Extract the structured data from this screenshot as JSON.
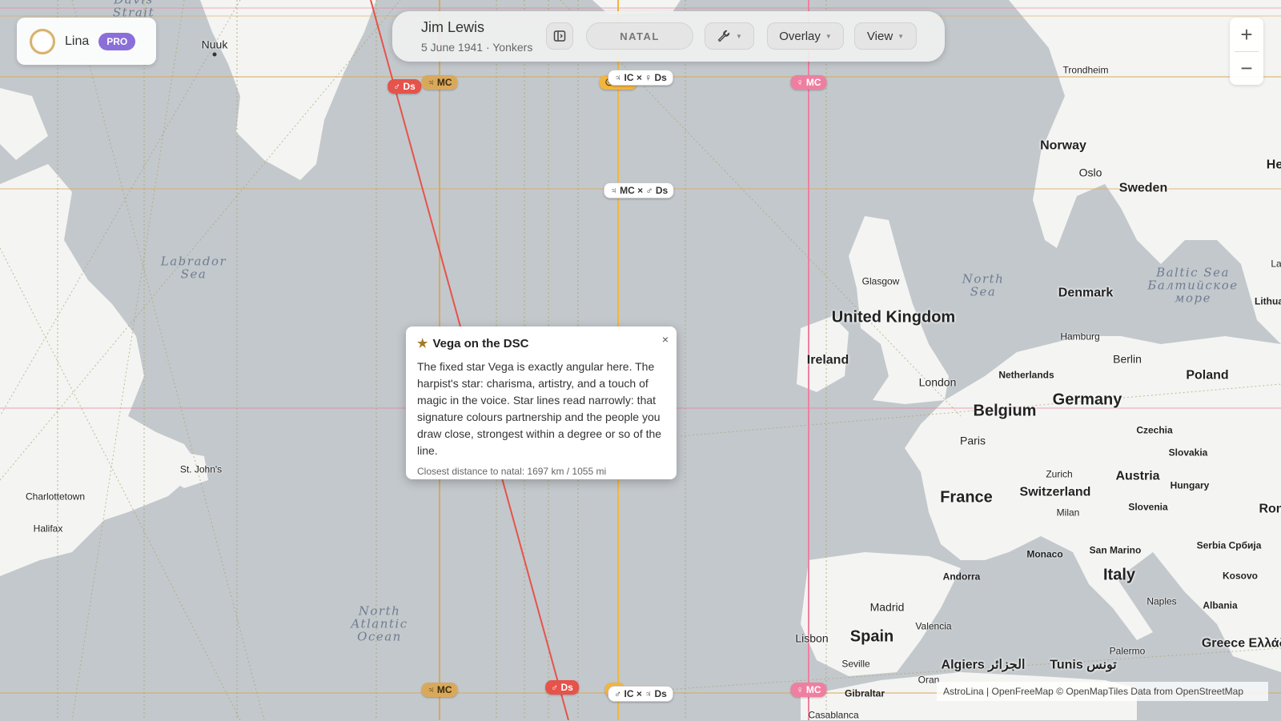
{
  "user": {
    "name": "Lina",
    "badge": "PRO"
  },
  "header": {
    "person_name": "Jim Lewis",
    "person_sub": "5 June 1941 · Yonkers",
    "natal_label": "NATAL",
    "overlay_label": "Overlay",
    "view_label": "View"
  },
  "zoom": {
    "in": "+",
    "out": "−"
  },
  "popup": {
    "title": "Vega on the DSC",
    "close": "×",
    "body": "The fixed star Vega is exactly angular here. The harpist's star: charisma, artistry, and a touch of magic in the voice. Star lines read narrowly: that signature colours partnership and the people you draw close, strongest within a degree or so of the line.",
    "footer": "Closest distance to natal: 1697 km / 1055 mi"
  },
  "attribution": "AstroLina | OpenFreeMap © OpenMapTiles Data from OpenStreetMap",
  "line_tags": [
    {
      "text": "♂ Ds",
      "color": "red"
    },
    {
      "text": "♃ MC",
      "color": "orange"
    },
    {
      "text": "♃ IC × ♀ Ds",
      "color": "white"
    },
    {
      "text": "♀ MC",
      "color": "pink"
    },
    {
      "text": "♃ MC × ♂ Ds",
      "color": "white"
    },
    {
      "text": "♃ MC",
      "color": "orange"
    },
    {
      "text": "♂ Ds",
      "color": "red"
    },
    {
      "text": "♂ IC × ♃ Ds",
      "color": "white"
    },
    {
      "text": "♀ MC",
      "color": "pink"
    },
    {
      "text": "☉ MC",
      "color": "yellow"
    },
    {
      "text": "☉",
      "color": "yellow"
    }
  ],
  "places": {
    "davis": "Davis\nStrait",
    "nuuk": "Nuuk",
    "labrador": "Labrador\nSea",
    "stjohns": "St. John's",
    "charlottetown": "Charlottetown",
    "halifax": "Halifax",
    "natlantic": "North\nAtlantic\nOcean",
    "trondheim": "Trondheim",
    "norway": "Norway",
    "oslo": "Oslo",
    "sweden": "Sweden",
    "he": "He",
    "glasgow": "Glasgow",
    "uk": "United\nKingdom",
    "northsea": "North\nSea",
    "baltic": "Baltic Sea\nБалтийское\nморе",
    "denmark": "Denmark",
    "lithua": "Lithua",
    "la": "La",
    "ireland": "Ireland",
    "hamburg": "Hamburg",
    "berlin": "Berlin",
    "poland": "Poland",
    "london": "London",
    "netherlands": "Netherlands",
    "belgium": "Belgium",
    "germany": "Germany",
    "czechia": "Czechia",
    "paris": "Paris",
    "slovakia": "Slovakia",
    "zurich": "Zurich",
    "austria": "Austria",
    "hungary": "Hungary",
    "france": "France",
    "switzerland": "Switzerland",
    "milan": "Milan",
    "slovenia": "Slovenia",
    "ron": "Ron",
    "monaco": "Monaco",
    "sanmarino": "San Marino",
    "serbia": "Serbia\nСрбија",
    "andorra": "Andorra",
    "italy": "Italy",
    "kosovo": "Kosovo",
    "madrid": "Madrid",
    "naples": "Naples",
    "albania": "Albania",
    "valencia": "Valencia",
    "spain": "Spain",
    "lisbon": "Lisbon",
    "algiers": "Algiers\nالجزائر",
    "tunis": "Tunis\nتونس",
    "palermo": "Palermo",
    "greece": "Greece\nΕλλάδα",
    "seville": "Seville",
    "oran": "Oran",
    "gibraltar": "Gibraltar",
    "casablanca": "Casablanca"
  }
}
